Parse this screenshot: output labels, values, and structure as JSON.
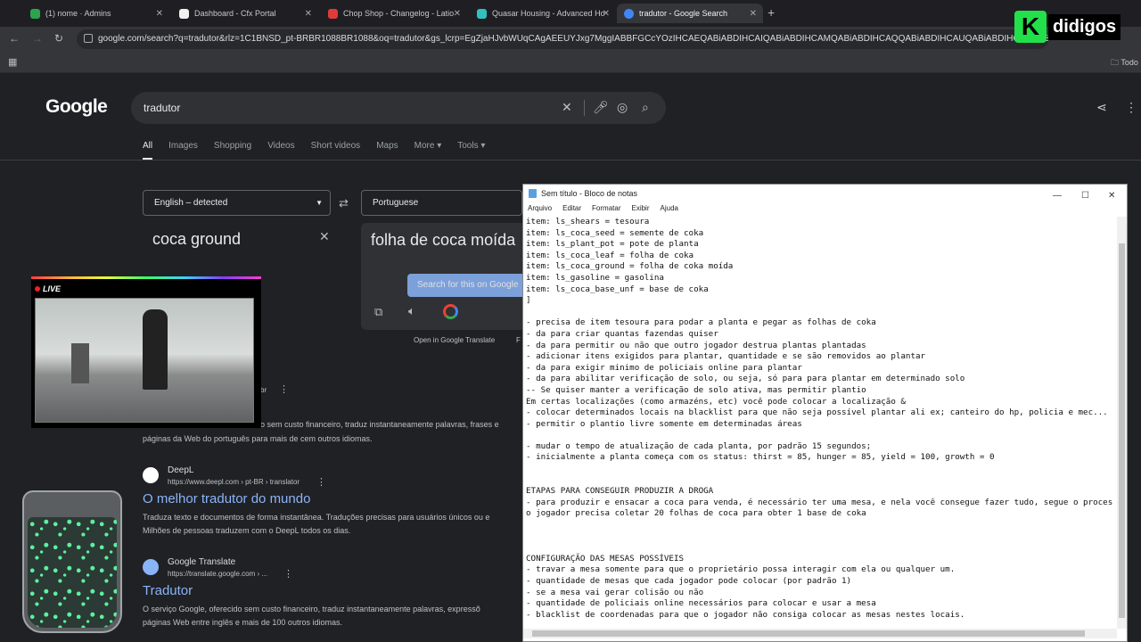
{
  "browser": {
    "tabs": [
      {
        "label": "(1) nome · Admins",
        "color": "#2ca44f"
      },
      {
        "label": "Dashboard - Cfx Portal",
        "color": "#f0f0f0"
      },
      {
        "label": "Chop Shop - Changelog - Latio",
        "color": "#e03b3b"
      },
      {
        "label": "Quasar Housing - Advanced Ho",
        "color": "#30c0c0"
      },
      {
        "label": "tradutor - Google Search",
        "color": "#4285f4"
      }
    ],
    "new_tab": "+",
    "url": "google.com/search?q=tradutor&rlz=1C1BNSD_pt-BRBR1088BR1088&oq=tradutor&gs_lcrp=EgZjaHJvbWUqCAgAEEUYJxg7MggIABBFGCcYOzIHCAEQABiABDIHCAIQABiABDIHCAMQABiABDIHCAQQABiABDIHCAUQABiABDIHCAYQABiABDIG",
    "bookmark_folder": "Todo"
  },
  "brand": {
    "letter": "K",
    "name": "didigos"
  },
  "google": {
    "logo": "Google",
    "query": "tradutor",
    "tabs": [
      "All",
      "Images",
      "Shopping",
      "Videos",
      "Short videos",
      "Maps",
      "More ▾",
      "Tools ▾"
    ]
  },
  "translate": {
    "source_lang": "English – detected",
    "target_lang": "Portuguese",
    "source_text": "coca ground",
    "target_text": "folha de coca moída",
    "search_button": "Search for this on Google",
    "open_link": "Open in Google Translate",
    "feedback": "F"
  },
  "results": {
    "partial_desc_1": "o sem custo financeiro, traduz instantaneamente palavras, frases e",
    "partial_desc_2": "páginas da Web do português para mais de cem outros idiomas.",
    "partial_url": "br",
    "deepl": {
      "site": "DeepL",
      "url": "https://www.deepl.com › pt-BR › translator",
      "title": "O melhor tradutor do mundo",
      "desc1": "Traduza texto e documentos de forma instantânea. Traduções precisas para usuários únicos ou e",
      "desc2": "Milhões de pessoas traduzem com o DeepL todos os dias."
    },
    "gtranslate": {
      "site": "Google Translate",
      "url": "https://translate.google.com › ...",
      "title": "Tradutor",
      "desc1": "O serviço Google, oferecido sem custo financeiro, traduz instantaneamente palavras, expressõ",
      "desc2": "páginas Web entre inglês e mais de 100 outros idiomas."
    }
  },
  "live": {
    "label": "LIVE"
  },
  "notepad": {
    "title": "Sem título - Bloco de notas",
    "menu": [
      "Arquivo",
      "Editar",
      "Formatar",
      "Exibir",
      "Ajuda"
    ],
    "lines": [
      "item: ls_shears = tesoura",
      "item: ls_coca_seed = semente de coka",
      "item: ls_plant_pot = pote de planta",
      "item: ls_coca_leaf = folha de coka",
      "item: ls_coca_ground = folha de coka moída",
      "item: ls_gasoline = gasolina",
      "item: ls_coca_base_unf = base de coka",
      "]",
      "",
      "- precisa de item tesoura para podar a planta e pegar as folhas de coka",
      "- da para criar quantas fazendas quiser",
      "- da para permitir ou não que outro jogador destrua plantas plantadas",
      "- adicionar itens exigidos para plantar, quantidade e se são removidos ao plantar",
      "- da para exigir minimo de policiais online para plantar",
      "- da para abilitar verificação de solo, ou seja, só para para plantar em determinado solo",
      "-- Se quiser manter a verificação de solo ativa, mas permitir plantio",
      "Em certas localizações (como armazéns, etc) você pode colocar a localização &",
      "- colocar determinados locais na blacklist para que não seja possível plantar ali ex; canteiro do hp, policia e mec...",
      "- permitir o plantio livre somente em determinadas áreas",
      "",
      "- mudar o tempo de atualização de cada planta, por padrão 15 segundos;",
      "- inicialmente a planta começa com os status: thirst = 85, hunger = 85, yield = 100, growth = 0",
      "",
      "",
      "ETAPAS PARA CONSEGUIR PRODUZIR A DROGA",
      "- para produzir e ensacar a coca para venda, é necessário ter uma mesa, e nela você consegue fazer tudo, segue o proces",
      "o jogador precisa coletar 20 folhas de coca para obter 1 base de coka",
      "",
      "",
      "",
      "CONFIGURAÇÃO DAS MESAS POSSÍVEIS",
      "- travar a mesa somente para que o proprietário possa interagir com ela ou qualquer um.",
      "- quantidade de mesas que cada jogador pode colocar (por padrão 1)",
      "- se a mesa vai gerar colisão ou não",
      "- quantidade de policiais online necessários para colocar e usar a mesa",
      "- blacklist de coordenadas para que o jogador não consiga colocar as mesas nestes locais."
    ]
  }
}
